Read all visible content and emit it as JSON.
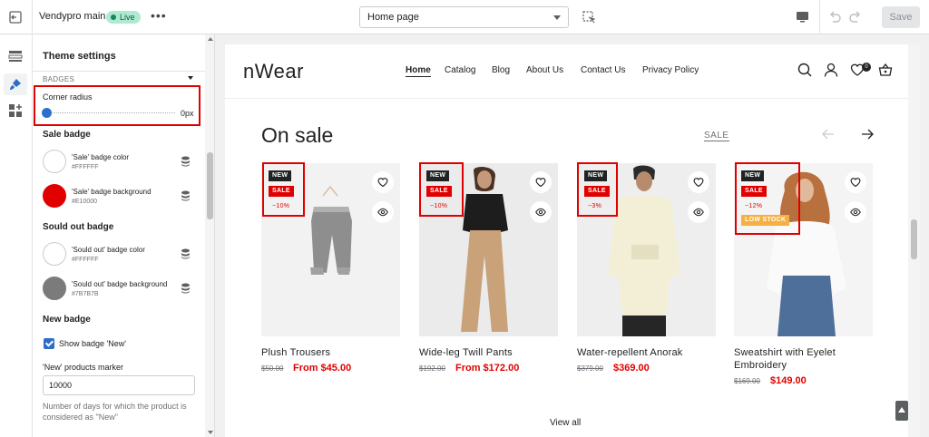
{
  "topbar": {
    "theme_name": "Vendypro main",
    "live_badge": "Live",
    "more": "•••",
    "page_select": "Home page",
    "save_label": "Save"
  },
  "panel": {
    "title": "Theme settings",
    "section": "BADGES",
    "corner_radius_label": "Corner radius",
    "corner_radius_value": "0px",
    "corner_radius_level": 0,
    "sale_badge": {
      "title": "Sale badge",
      "color_name": "'Sale' badge color",
      "color_hex": "#FFFFFF",
      "bg_name": "'Sale' badge background",
      "bg_hex": "#E10000"
    },
    "sold_out_badge": {
      "title": "Sould out badge",
      "color_name": "'Sould out' badge color",
      "color_hex": "#FFFFFF",
      "bg_name": "'Sould out' badge background",
      "bg_hex": "#7B7B7B"
    },
    "new_badge": {
      "title": "New badge",
      "show_label": "Show badge 'New'",
      "show_checked": true,
      "marker_label": "'New' products marker",
      "marker_value": "10000",
      "help": "Number of days for which the product is considered as \"New\""
    }
  },
  "preview": {
    "logo": "nWear",
    "nav": [
      "Home",
      "Catalog",
      "Blog",
      "About Us",
      "Contact Us",
      "Privacy Policy"
    ],
    "cart_count": "0",
    "section_title": "On sale",
    "section_link": "SALE",
    "view_all": "View all",
    "products": [
      {
        "title": "Plush Trousers",
        "old_price": "$50.00",
        "price": "From $45.00",
        "badges": {
          "new": "NEW",
          "sale": "SALE",
          "pct": "−10%"
        }
      },
      {
        "title": "Wide-leg Twill Pants",
        "old_price": "$192.00",
        "price": "From $172.00",
        "badges": {
          "new": "NEW",
          "sale": "SALE",
          "pct": "−10%"
        }
      },
      {
        "title": "Water-repellent Anorak",
        "old_price": "$379.00",
        "price": "$369.00",
        "badges": {
          "new": "NEW",
          "sale": "SALE",
          "pct": "−3%"
        }
      },
      {
        "title": "Sweatshirt with Eyelet Embroidery",
        "old_price": "$169.00",
        "price": "$149.00",
        "badges": {
          "new": "NEW",
          "sale": "SALE",
          "pct": "−12%",
          "low": "LOW STOCK"
        }
      }
    ]
  },
  "colors": {
    "accent": "#2C6ECB",
    "sale_red": "#E10000",
    "highlight": "#E10000",
    "low_stock": "#F5B041"
  },
  "icons": [
    "exit-icon",
    "inspect-icon",
    "desktop-icon",
    "undo-icon",
    "redo-icon",
    "sections-icon",
    "theme-settings-icon",
    "apps-icon",
    "database-icon",
    "search-icon",
    "account-icon",
    "wishlist-icon",
    "cart-icon",
    "heart-icon",
    "eye-icon",
    "arrow-left-icon",
    "arrow-right-icon",
    "scroll-top-icon"
  ]
}
